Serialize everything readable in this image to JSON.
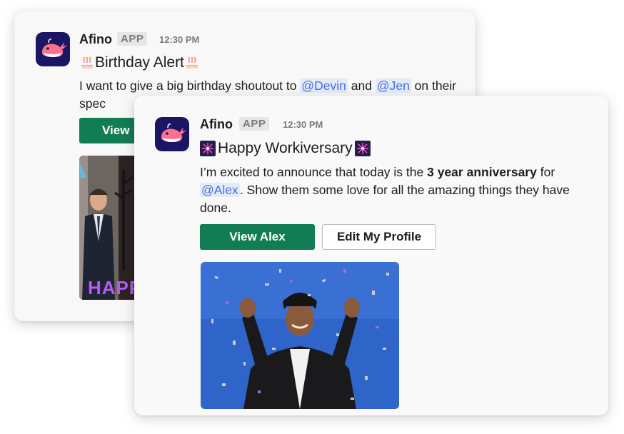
{
  "birthday_message": {
    "sender": "Afino",
    "badge": "APP",
    "time": "12:30 PM",
    "title": "Birthday Alert",
    "title_emoji": "birthday-cake",
    "body_prefix": "I want to give a big birthday shoutout to ",
    "mention_1": "@Devin",
    "body_and": " and ",
    "mention_2": "@Jen",
    "body_suffix": " on their spec",
    "button_label": "View",
    "gif_caption": "HAPP"
  },
  "workiversary_message": {
    "sender": "Afino",
    "badge": "APP",
    "time": "12:30 PM",
    "title": "Happy Workiversary",
    "title_emoji": "fireworks",
    "body_prefix": "I’m excited to announce that today is the ",
    "body_bold": "3 year anniversary",
    "body_for": " for ",
    "mention": "@Alex",
    "body_suffix": ". Show them some love for all the amazing things they have done.",
    "primary_button": "View Alex",
    "secondary_button": "Edit My Profile"
  },
  "colors": {
    "accent_green": "#127c55",
    "mention_bg": "#e3ebfb",
    "mention_text": "#4a6ee0",
    "avatar_bg": "#1b1663"
  }
}
